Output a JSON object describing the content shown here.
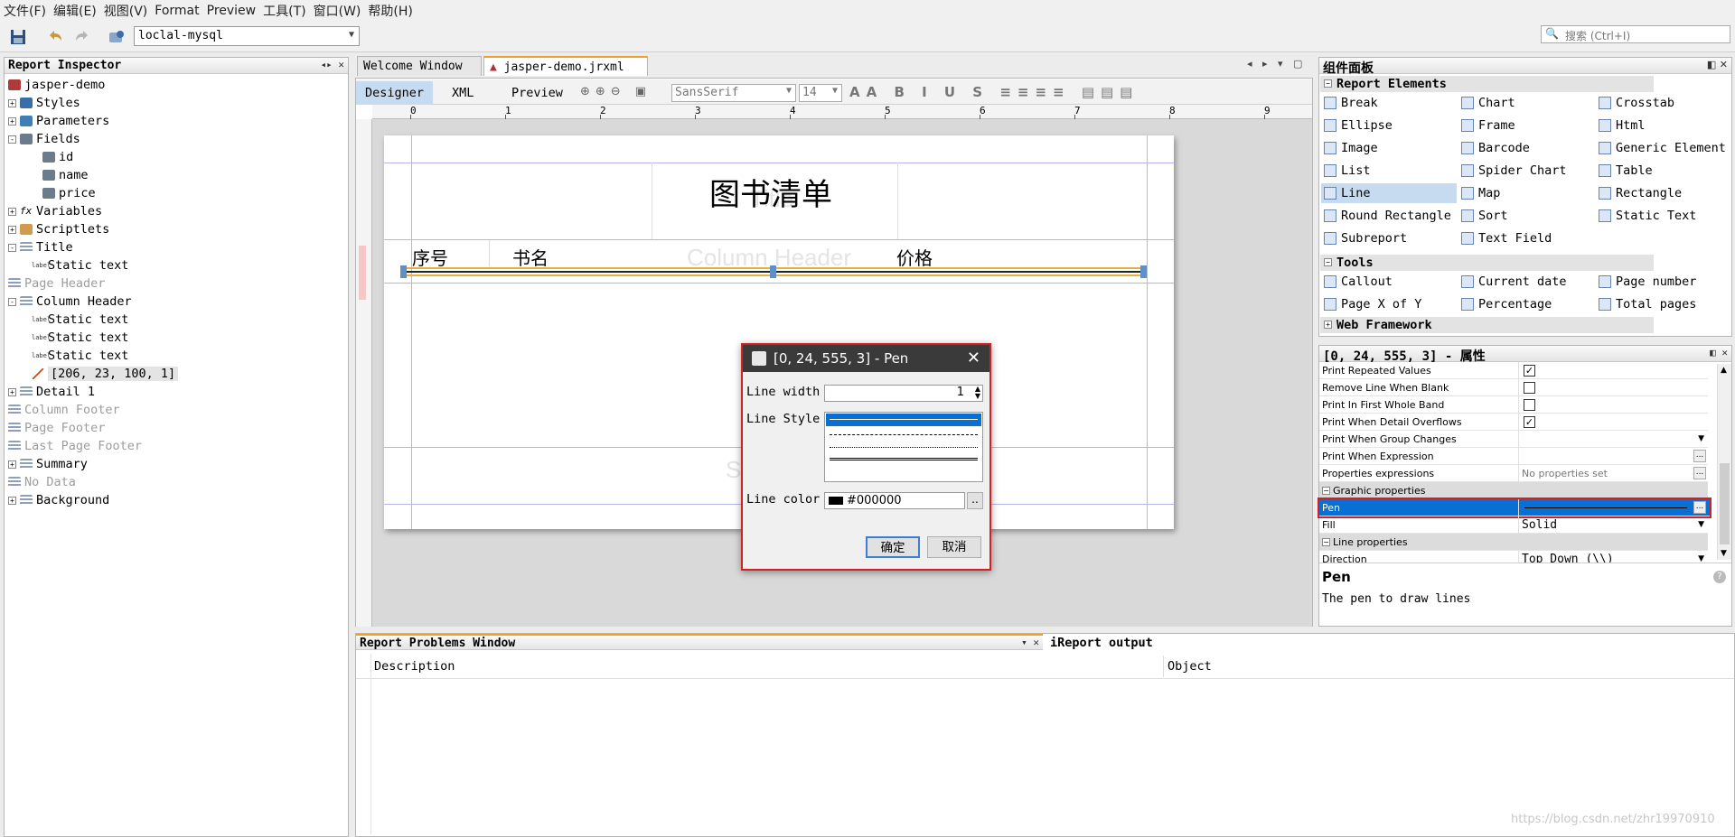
{
  "menu": [
    "文件(F)",
    "编辑(E)",
    "视图(V)",
    "Format",
    "Preview",
    "工具(T)",
    "窗口(W)",
    "帮助(H)"
  ],
  "toolbar": {
    "connection": "loclal-mysql",
    "search_placeholder": "搜索 (Ctrl+I)"
  },
  "inspector": {
    "title": "Report Inspector",
    "items": [
      {
        "label": "jasper-demo",
        "indent": 0,
        "pm": "",
        "dim": false,
        "icon": "report-icon"
      },
      {
        "label": "Styles",
        "indent": 0,
        "pm": "+",
        "dim": false,
        "icon": "styles-icon"
      },
      {
        "label": "Parameters",
        "indent": 0,
        "pm": "+",
        "dim": false,
        "icon": "parameters-icon"
      },
      {
        "label": "Fields",
        "indent": 0,
        "pm": "-",
        "dim": false,
        "icon": "database-icon"
      },
      {
        "label": "id",
        "indent": 2,
        "pm": "",
        "dim": false,
        "icon": "field-icon"
      },
      {
        "label": "name",
        "indent": 2,
        "pm": "",
        "dim": false,
        "icon": "field-icon"
      },
      {
        "label": "price",
        "indent": 2,
        "pm": "",
        "dim": false,
        "icon": "field-icon"
      },
      {
        "label": "Variables",
        "indent": 0,
        "pm": "+",
        "dim": false,
        "icon": "variables-icon"
      },
      {
        "label": "Scriptlets",
        "indent": 0,
        "pm": "+",
        "dim": false,
        "icon": "scriptlets-icon"
      },
      {
        "label": "Title",
        "indent": 0,
        "pm": "-",
        "dim": false,
        "icon": "band-icon"
      },
      {
        "label": "Static text",
        "indent": 1,
        "pm": "",
        "dim": false,
        "icon": "label-icon"
      },
      {
        "label": "Page Header",
        "indent": 0,
        "pm": "",
        "dim": true,
        "icon": "band-icon"
      },
      {
        "label": "Column Header",
        "indent": 0,
        "pm": "-",
        "dim": false,
        "icon": "band-icon"
      },
      {
        "label": "Static text",
        "indent": 1,
        "pm": "",
        "dim": false,
        "icon": "label-icon"
      },
      {
        "label": "Static text",
        "indent": 1,
        "pm": "",
        "dim": false,
        "icon": "label-icon"
      },
      {
        "label": "Static text",
        "indent": 1,
        "pm": "",
        "dim": false,
        "icon": "label-icon"
      },
      {
        "label": "[206, 23, 100, 1]",
        "indent": 1,
        "pm": "",
        "dim": false,
        "icon": "line-icon"
      },
      {
        "label": "Detail 1",
        "indent": 0,
        "pm": "+",
        "dim": false,
        "icon": "band-icon"
      },
      {
        "label": "Column Footer",
        "indent": 0,
        "pm": "",
        "dim": true,
        "icon": "band-icon"
      },
      {
        "label": "Page Footer",
        "indent": 0,
        "pm": "",
        "dim": true,
        "icon": "band-icon"
      },
      {
        "label": "Last Page Footer",
        "indent": 0,
        "pm": "",
        "dim": true,
        "icon": "band-icon"
      },
      {
        "label": "Summary",
        "indent": 0,
        "pm": "+",
        "dim": false,
        "icon": "band-icon"
      },
      {
        "label": "No Data",
        "indent": 0,
        "pm": "",
        "dim": true,
        "icon": "band-icon"
      },
      {
        "label": "Background",
        "indent": 0,
        "pm": "+",
        "dim": false,
        "icon": "band-icon"
      }
    ]
  },
  "tabs": [
    {
      "label": "Welcome Window"
    },
    {
      "label": "jasper-demo.jrxml"
    }
  ],
  "subtabs": [
    "Designer",
    "XML",
    "Preview"
  ],
  "format": {
    "font": "SansSerif",
    "size": "14"
  },
  "ruler": [
    "0",
    "1",
    "2",
    "3",
    "4",
    "5",
    "6",
    "7",
    "8",
    "9"
  ],
  "report": {
    "title_text": "图书清单",
    "title_band": "Title",
    "col_header_band": "Column Header",
    "detail_band": "S",
    "headers": [
      "序号",
      "书名",
      "价格"
    ]
  },
  "dialog": {
    "title": "[0, 24, 555, 3] - Pen",
    "line_width_label": "Line width",
    "line_width_value": "1",
    "line_style_label": "Line Style",
    "line_color_label": "Line color",
    "line_color_value": "#000000",
    "color_swatch": "#000000",
    "more_button": "..",
    "ok": "确定",
    "cancel": "取消"
  },
  "palette": {
    "title": "组件面板",
    "sections": {
      "report": "Report Elements",
      "tools": "Tools",
      "web": "Web Framework"
    },
    "report_items": [
      {
        "label": "Break",
        "icon": "break-icon"
      },
      {
        "label": "Chart",
        "icon": "chart-icon"
      },
      {
        "label": "Crosstab",
        "icon": "crosstab-icon"
      },
      {
        "label": "Ellipse",
        "icon": "ellipse-icon"
      },
      {
        "label": "Frame",
        "icon": "frame-icon"
      },
      {
        "label": "Html",
        "icon": "html-icon"
      },
      {
        "label": "Image",
        "icon": "image-icon"
      },
      {
        "label": "Barcode",
        "icon": "barcode-icon"
      },
      {
        "label": "Generic Element",
        "icon": "generic-icon"
      },
      {
        "label": "List",
        "icon": "list-icon"
      },
      {
        "label": "Spider Chart",
        "icon": "spider-icon"
      },
      {
        "label": "Table",
        "icon": "table-icon"
      },
      {
        "label": "Line",
        "icon": "line-icon"
      },
      {
        "label": "Map",
        "icon": "map-icon"
      },
      {
        "label": "Rectangle",
        "icon": "rectangle-icon"
      },
      {
        "label": "Round Rectangle",
        "icon": "round-rect-icon"
      },
      {
        "label": "Sort",
        "icon": "sort-icon"
      },
      {
        "label": "Static Text",
        "icon": "static-text-icon"
      },
      {
        "label": "Subreport",
        "icon": "subreport-icon"
      },
      {
        "label": "Text Field",
        "icon": "text-field-icon"
      }
    ],
    "tool_items": [
      {
        "label": "Callout",
        "icon": "callout-icon"
      },
      {
        "label": "Current date",
        "icon": "calendar-icon"
      },
      {
        "label": "Page number",
        "icon": "hash-icon"
      },
      {
        "label": "Page X of Y",
        "icon": "pagexy-icon"
      },
      {
        "label": "Percentage",
        "icon": "percent-icon"
      },
      {
        "label": "Total pages",
        "icon": "hash-icon"
      }
    ]
  },
  "props": {
    "title": "[0, 24, 555, 3] - 属性",
    "rows": [
      {
        "name": "Print Repeated Values",
        "type": "check",
        "checked": true
      },
      {
        "name": "Remove Line When Blank",
        "type": "check",
        "checked": false
      },
      {
        "name": "Print In First Whole Band",
        "type": "check",
        "checked": false
      },
      {
        "name": "Print When Detail Overflows",
        "type": "check",
        "checked": true
      },
      {
        "name": "Print When Group Changes",
        "type": "combo",
        "value": ""
      },
      {
        "name": "Print When Expression",
        "type": "dots",
        "value": ""
      },
      {
        "name": "Properties expressions",
        "type": "dots",
        "value": "No properties set"
      },
      {
        "name": "Graphic properties",
        "type": "section"
      },
      {
        "name": "Pen",
        "type": "pen",
        "selected": true
      },
      {
        "name": "Fill",
        "type": "combo",
        "value": "Solid"
      },
      {
        "name": "Line properties",
        "type": "section"
      },
      {
        "name": "Direction",
        "type": "combo",
        "value": "Top Down (\\\\)"
      }
    ],
    "desc_title": "Pen",
    "desc_text": "The pen to draw lines"
  },
  "problems": {
    "title": "Report Problems Window",
    "output_tab": "iReport output",
    "cols": [
      "Description",
      "Object"
    ]
  },
  "watermark": "https://blog.csdn.net/zhr19970910"
}
